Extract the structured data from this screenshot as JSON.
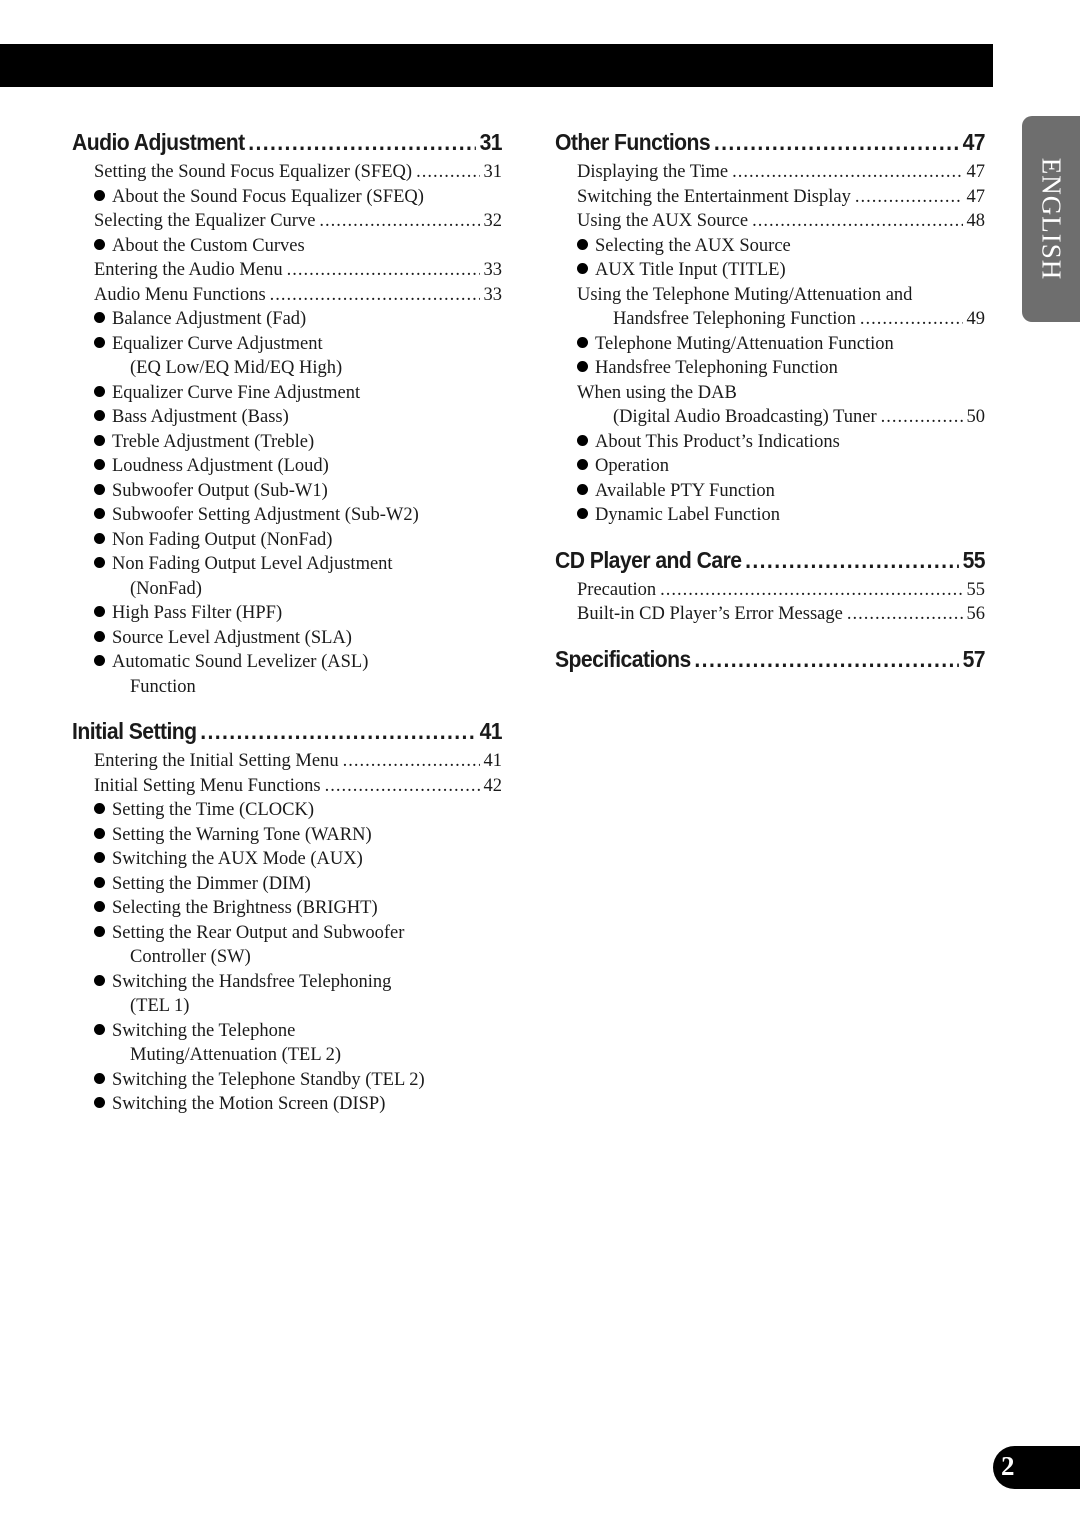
{
  "language_tab": "ENGLISH",
  "page_number": "2",
  "columns": [
    {
      "sections": [
        {
          "title": "Audio Adjustment",
          "page": "31",
          "entries": [
            {
              "level": 1,
              "text": "Setting the Sound Focus Equalizer (SFEQ)",
              "page": "31"
            },
            {
              "level": 2,
              "text": "About the Sound Focus Equalizer (SFEQ)"
            },
            {
              "level": 1,
              "text": "Selecting the Equalizer Curve",
              "page": "32"
            },
            {
              "level": 2,
              "text": "About the Custom Curves"
            },
            {
              "level": 1,
              "text": "Entering the Audio Menu",
              "page": "33"
            },
            {
              "level": 1,
              "text": "Audio Menu Functions",
              "page": "33"
            },
            {
              "level": 2,
              "text": "Balance Adjustment (Fad)"
            },
            {
              "level": 2,
              "text": "Equalizer Curve Adjustment"
            },
            {
              "level": 3,
              "text": "(EQ Low/EQ Mid/EQ High)"
            },
            {
              "level": 2,
              "text": "Equalizer Curve Fine Adjustment"
            },
            {
              "level": 2,
              "text": "Bass Adjustment (Bass)"
            },
            {
              "level": 2,
              "text": "Treble Adjustment (Treble)"
            },
            {
              "level": 2,
              "text": "Loudness Adjustment (Loud)"
            },
            {
              "level": 2,
              "text": "Subwoofer Output (Sub-W1)"
            },
            {
              "level": 2,
              "text": "Subwoofer Setting Adjustment (Sub-W2)"
            },
            {
              "level": 2,
              "text": "Non Fading Output (NonFad)"
            },
            {
              "level": 2,
              "text": "Non Fading Output Level Adjustment"
            },
            {
              "level": 3,
              "text": "(NonFad)"
            },
            {
              "level": 2,
              "text": "High Pass Filter (HPF)"
            },
            {
              "level": 2,
              "text": "Source Level Adjustment (SLA)"
            },
            {
              "level": 2,
              "text": "Automatic Sound Levelizer (ASL)"
            },
            {
              "level": 3,
              "text": "Function"
            }
          ]
        },
        {
          "title": "Initial Setting",
          "page": "41",
          "entries": [
            {
              "level": 1,
              "text": "Entering the Initial Setting Menu",
              "page": "41"
            },
            {
              "level": 1,
              "text": "Initial Setting Menu Functions",
              "page": "42"
            },
            {
              "level": 2,
              "text": "Setting the Time (CLOCK)"
            },
            {
              "level": 2,
              "text": "Setting the Warning Tone (WARN)"
            },
            {
              "level": 2,
              "text": "Switching the AUX Mode (AUX)"
            },
            {
              "level": 2,
              "text": "Setting the Dimmer (DIM)"
            },
            {
              "level": 2,
              "text": "Selecting the Brightness (BRIGHT)"
            },
            {
              "level": 2,
              "text": "Setting the Rear Output and Subwoofer"
            },
            {
              "level": 3,
              "text": "Controller (SW)"
            },
            {
              "level": 2,
              "text": "Switching the Handsfree Telephoning"
            },
            {
              "level": 3,
              "text": "(TEL 1)"
            },
            {
              "level": 2,
              "text": "Switching the Telephone"
            },
            {
              "level": 3,
              "text": "Muting/Attenuation (TEL 2)"
            },
            {
              "level": 2,
              "text": "Switching the Telephone Standby (TEL 2)"
            },
            {
              "level": 2,
              "text": "Switching the Motion Screen (DISP)"
            }
          ]
        }
      ]
    },
    {
      "sections": [
        {
          "title": "Other Functions",
          "page": "47",
          "entries": [
            {
              "level": 1,
              "text": "Displaying the Time",
              "page": "47"
            },
            {
              "level": 1,
              "text": "Switching the Entertainment Display",
              "page": "47"
            },
            {
              "level": 1,
              "text": "Using the AUX Source",
              "page": "48"
            },
            {
              "level": 2,
              "text": "Selecting the AUX Source"
            },
            {
              "level": 2,
              "text": "AUX Title Input (TITLE)"
            },
            {
              "level": 1,
              "text": "Using the Telephone Muting/Attenuation and"
            },
            {
              "level": 4,
              "text": "Handsfree Telephoning Function",
              "page": "49"
            },
            {
              "level": 2,
              "text": "Telephone Muting/Attenuation Function"
            },
            {
              "level": 2,
              "text": "Handsfree Telephoning Function"
            },
            {
              "level": 1,
              "text": "When using the DAB"
            },
            {
              "level": 4,
              "text": "(Digital Audio Broadcasting) Tuner",
              "page": "50"
            },
            {
              "level": 2,
              "text": "About This Product’s Indications"
            },
            {
              "level": 2,
              "text": "Operation"
            },
            {
              "level": 2,
              "text": "Available PTY Function"
            },
            {
              "level": 2,
              "text": "Dynamic Label Function"
            }
          ]
        },
        {
          "title": "CD Player and Care",
          "page": "55",
          "entries": [
            {
              "level": 1,
              "text": "Precaution",
              "page": "55"
            },
            {
              "level": 1,
              "text": "Built-in CD Player’s Error Message",
              "page": "56"
            }
          ]
        },
        {
          "title": "Specifications",
          "page": "57",
          "entries": []
        }
      ]
    }
  ]
}
